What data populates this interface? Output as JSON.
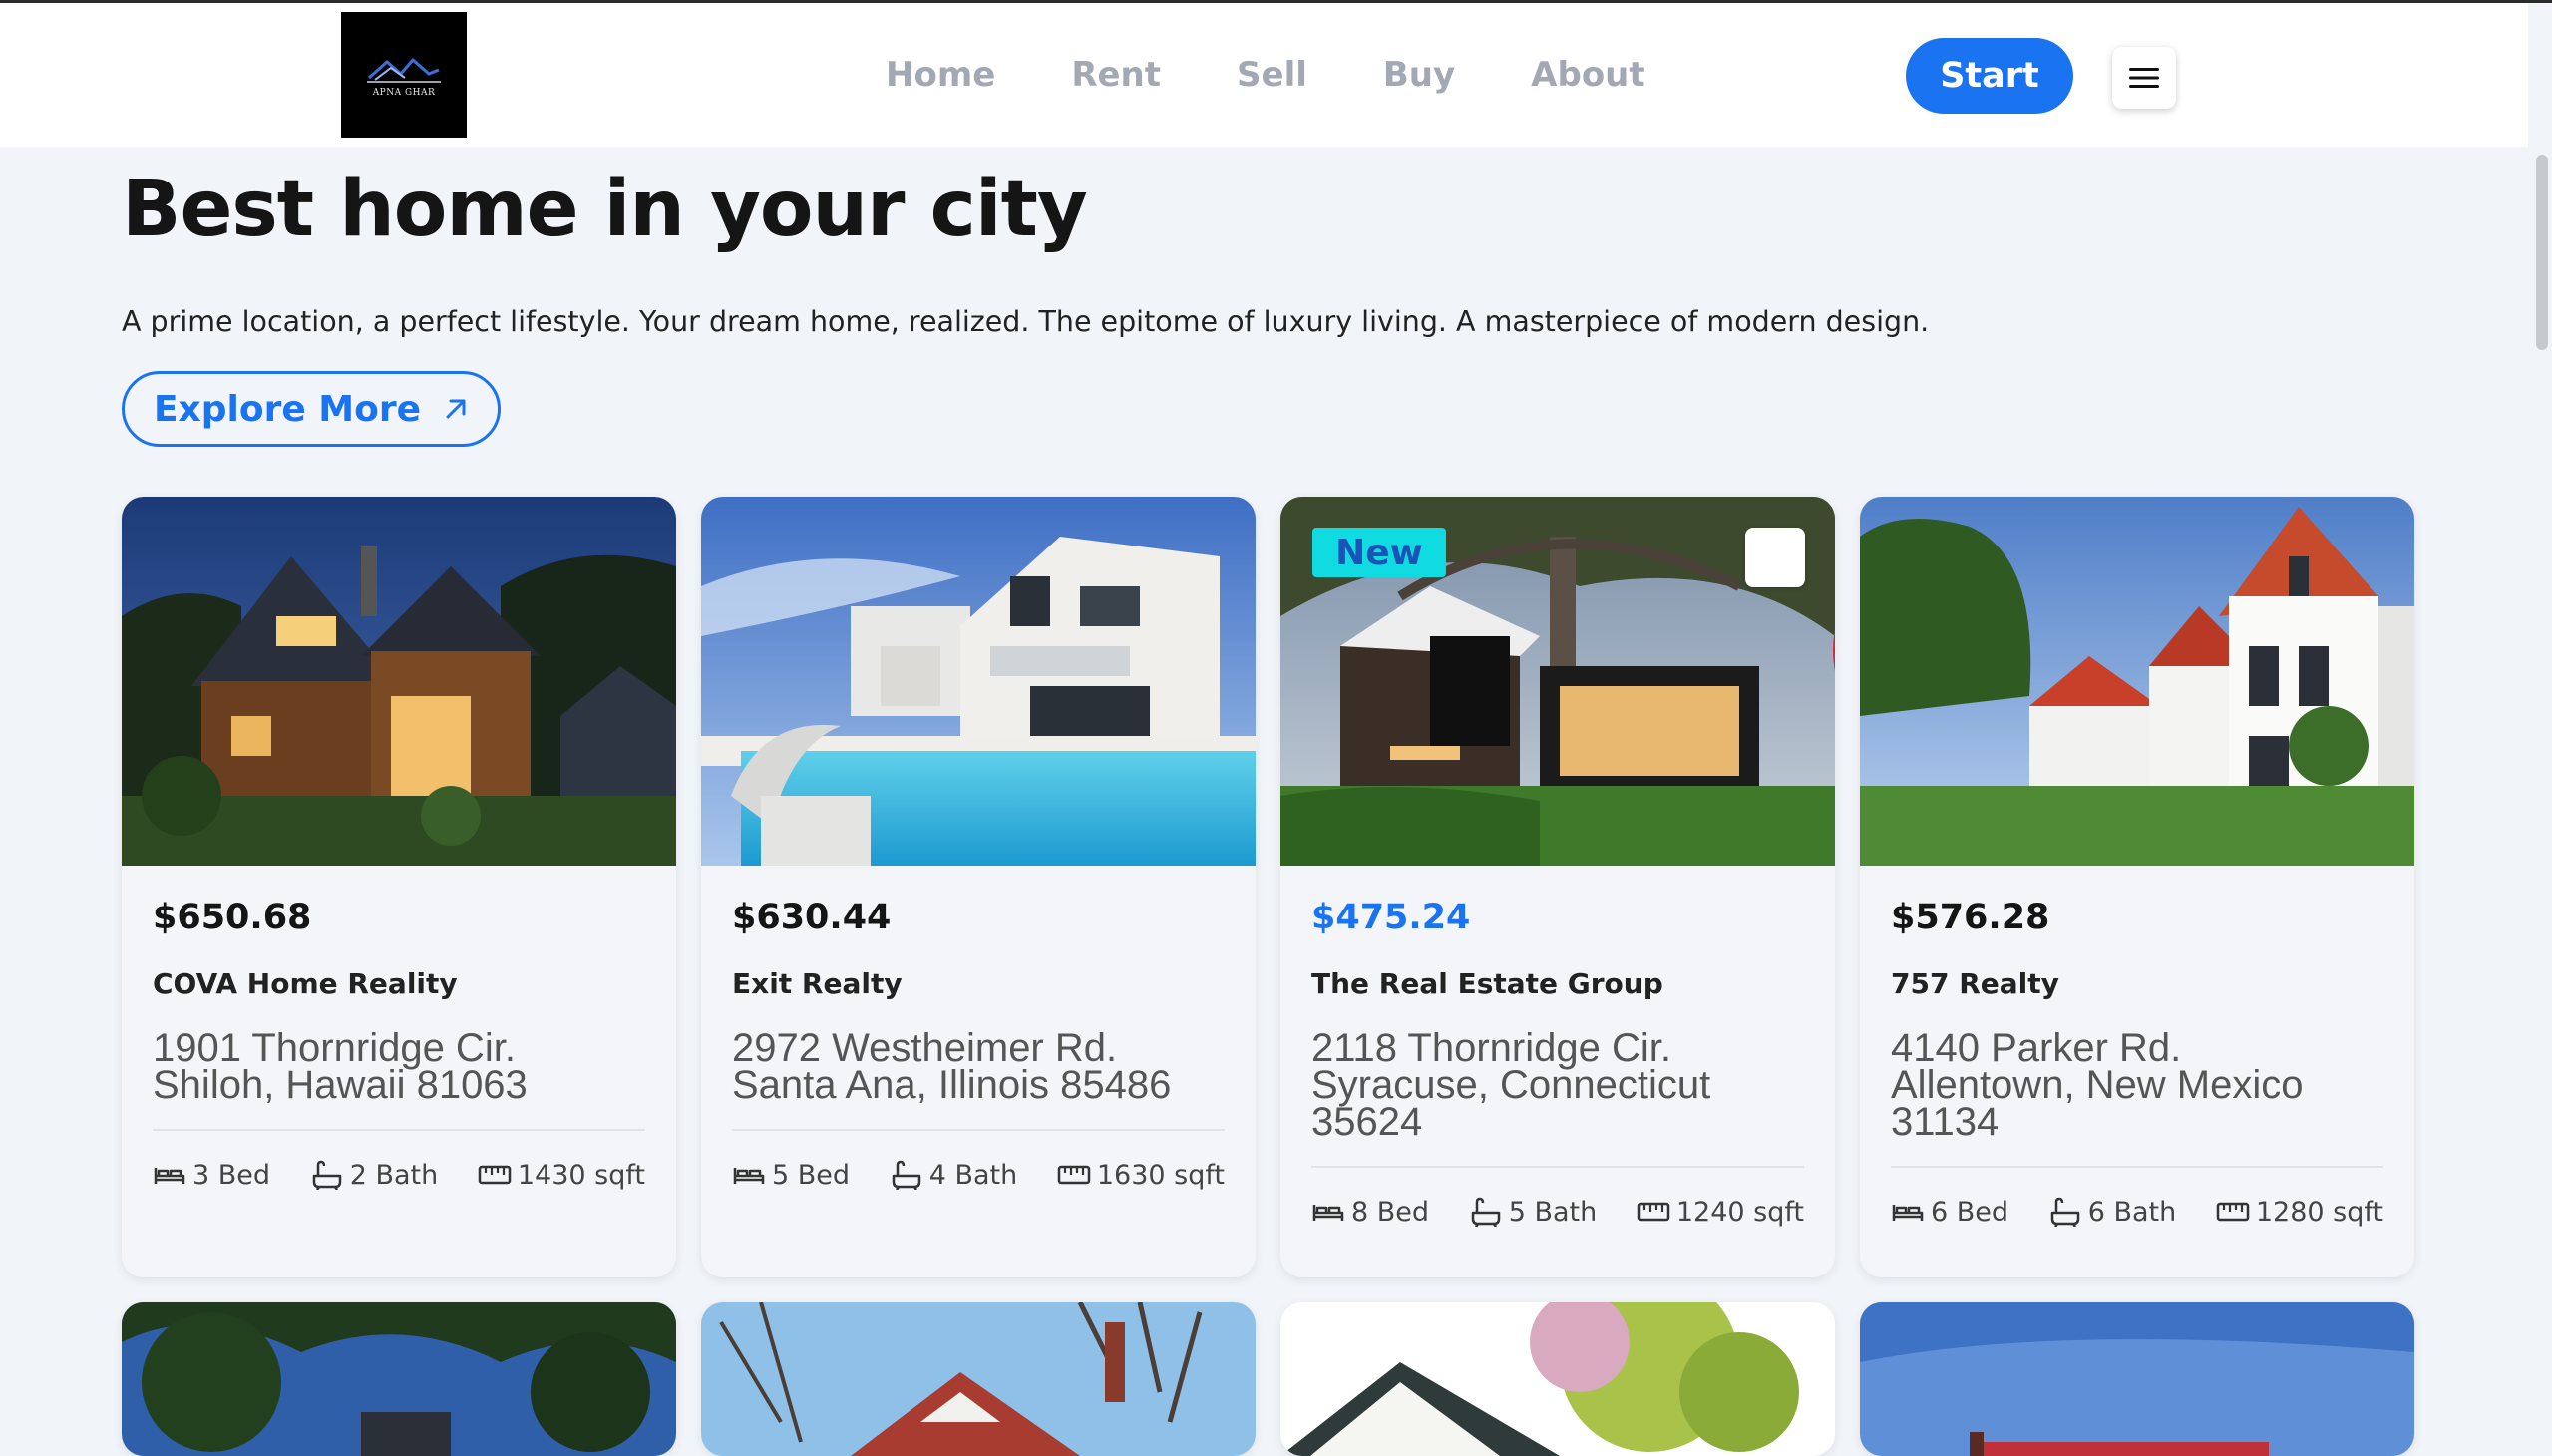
{
  "brand": {
    "logo_text": "APNA GHAR"
  },
  "nav": {
    "items": [
      "Home",
      "Rent",
      "Sell",
      "Buy",
      "About"
    ]
  },
  "header": {
    "start_label": "Start"
  },
  "hero": {
    "title": "Best home in your city",
    "subtitle": "A prime location, a perfect lifestyle. Your dream home, realized. The epitome of luxury living. A masterpiece of modern design.",
    "explore_label": "Explore More"
  },
  "accent_color": "#1a73f0",
  "badge_color": "#0fdbe0",
  "listings": [
    {
      "price": "$650.68",
      "agency": "COVA Home Reality",
      "address_line1": "1901 Thornridge Cir.",
      "address_line2": "Shiloh, Hawaii 81063",
      "beds": "3 Bed",
      "baths": "2 Bath",
      "area": "1430 sqft",
      "image": "wooden house at dusk"
    },
    {
      "price": "$630.44",
      "agency": "Exit Realty",
      "address_line1": "2972 Westheimer Rd.",
      "address_line2": "Santa Ana, Illinois 85486",
      "beds": "5 Bed",
      "baths": "4 Bath",
      "area": "1630 sqft",
      "image": "modern white villa with pool"
    },
    {
      "price": "$475.24",
      "agency": "The Real Estate Group",
      "address_line1": "2118 Thornridge Cir.",
      "address_line2": "Syracuse, Connecticut 35624",
      "beds": "8 Bed",
      "baths": "5 Bath",
      "area": "1240 sqft",
      "badge": "New",
      "favorite_icon": "heart-icon",
      "image": "modern dark house with lawn"
    },
    {
      "price": "$576.28",
      "agency": "757 Realty",
      "address_line1": "4140 Parker Rd.",
      "address_line2": "Allentown, New Mexico 31134",
      "beds": "6 Bed",
      "baths": "6 Bath",
      "area": "1280 sqft",
      "image": "white row houses with red roofs"
    }
  ],
  "icons": {
    "menu": "hamburger-icon",
    "explore_arrow": "arrow-up-right-icon",
    "bed": "bed-icon",
    "bath": "bath-icon",
    "area": "ruler-icon"
  }
}
